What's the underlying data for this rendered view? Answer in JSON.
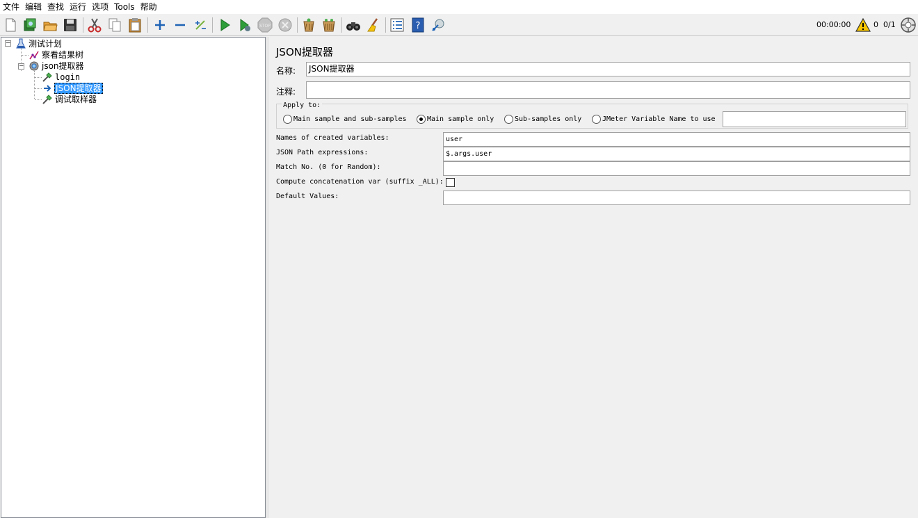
{
  "menu": [
    "文件",
    "编辑",
    "查找",
    "运行",
    "选项",
    "Tools",
    "帮助"
  ],
  "toolbar": {
    "icons": [
      "new-file-icon",
      "templates-icon",
      "open-icon",
      "save-icon",
      "cut-icon",
      "copy-icon",
      "paste-icon",
      "expand-icon",
      "collapse-icon",
      "toggle-icon",
      "start-icon",
      "start-no-pause-icon",
      "stop-icon",
      "shutdown-icon",
      "clear-icon",
      "clear-all-icon",
      "search-icon",
      "reset-search-icon",
      "function-helper-icon",
      "help-icon",
      "remote-icon"
    ],
    "timer": "00:00:00",
    "error_count": "0",
    "threads": "0/1"
  },
  "tree": {
    "root": "测试计划",
    "children": [
      "察看结果树",
      "json提取器"
    ],
    "grandchildren": [
      "login",
      "JSON提取器",
      "调试取样器"
    ]
  },
  "panel": {
    "title": "JSON提取器",
    "name_label": "名称:",
    "name_value": "JSON提取器",
    "comment_label": "注释:",
    "comment_value": "",
    "apply_to": {
      "legend": "Apply to:",
      "options": [
        "Main sample and sub-samples",
        "Main sample only",
        "Sub-samples only",
        "JMeter Variable Name to use"
      ],
      "selected": "Main sample only",
      "variable_value": ""
    },
    "fields": [
      {
        "label": "Names of created variables:",
        "value": "user"
      },
      {
        "label": "JSON Path expressions:",
        "value": "$.args.user"
      },
      {
        "label": "Match No. (0 for Random):",
        "value": ""
      },
      {
        "label": "Compute concatenation var (suffix _ALL):",
        "value": ""
      },
      {
        "label": "Default Values:",
        "value": ""
      }
    ],
    "concat_checked": false
  }
}
